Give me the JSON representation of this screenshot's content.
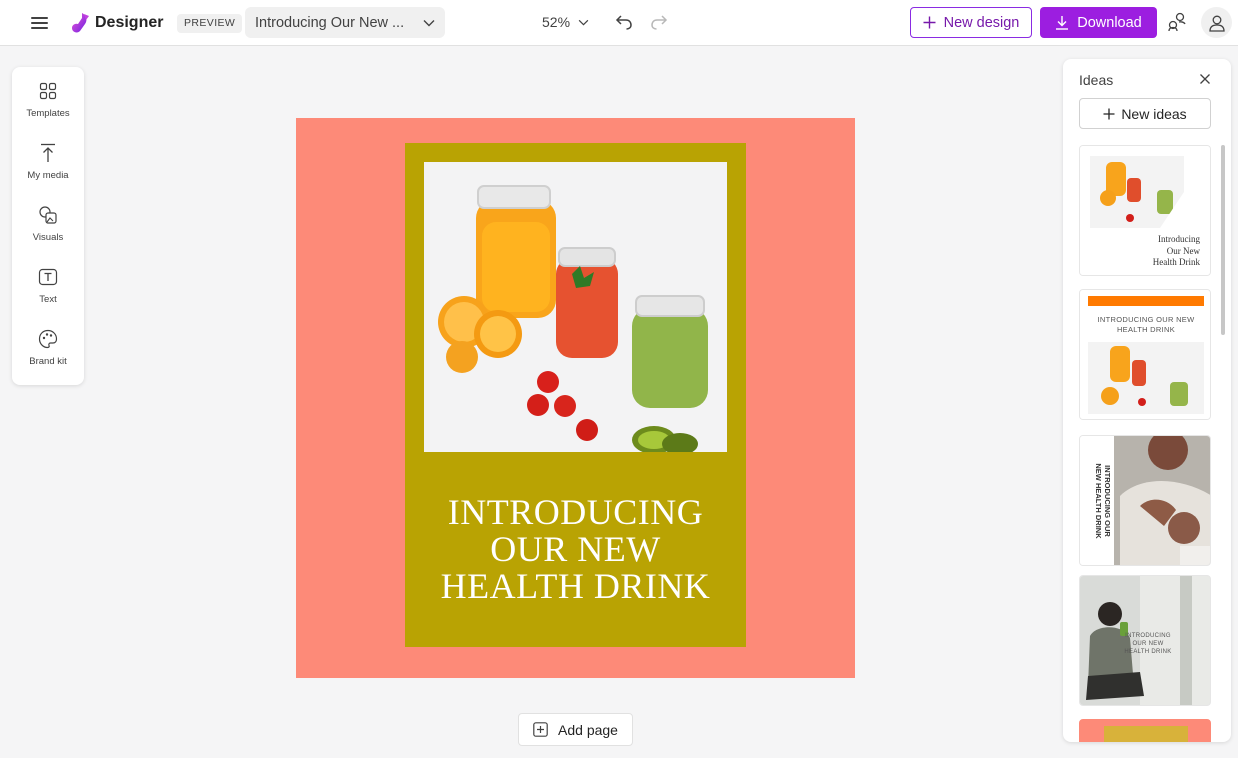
{
  "app": {
    "name": "Designer",
    "badge": "PREVIEW"
  },
  "header": {
    "title": "Introducing Our New ...",
    "zoom": "52%",
    "new_design_label": "New design",
    "download_label": "Download"
  },
  "sidebar": {
    "items": [
      {
        "label": "Templates",
        "icon": "templates-icon"
      },
      {
        "label": "My media",
        "icon": "upload-icon"
      },
      {
        "label": "Visuals",
        "icon": "visuals-icon"
      },
      {
        "label": "Text",
        "icon": "text-icon"
      },
      {
        "label": "Brand kit",
        "icon": "palette-icon"
      }
    ]
  },
  "canvas": {
    "headline_lines": [
      "INTRODUCING",
      "OUR NEW",
      "HEALTH DRINK"
    ],
    "colors": {
      "background": "#fd8a78",
      "panel": "#b9a303",
      "text": "#ffffff"
    }
  },
  "add_page_label": "Add page",
  "ideas": {
    "title": "Ideas",
    "new_ideas_label": "New ideas",
    "thumbnails": [
      {
        "text_lines": [
          "Introducing",
          "Our New",
          "Health Drink"
        ]
      },
      {
        "text_lines": [
          "INTRODUCING OUR NEW",
          "HEALTH DRINK"
        ]
      },
      {
        "text_lines": [
          "INTRODUCING OUR",
          "NEW HEALTH DRINK"
        ]
      },
      {
        "text_lines": [
          "INTRODUCING",
          "OUR NEW",
          "HEALTH DRINK"
        ]
      }
    ]
  },
  "colors": {
    "accent": "#9c1ee0",
    "accent_text": "#7719aa"
  }
}
